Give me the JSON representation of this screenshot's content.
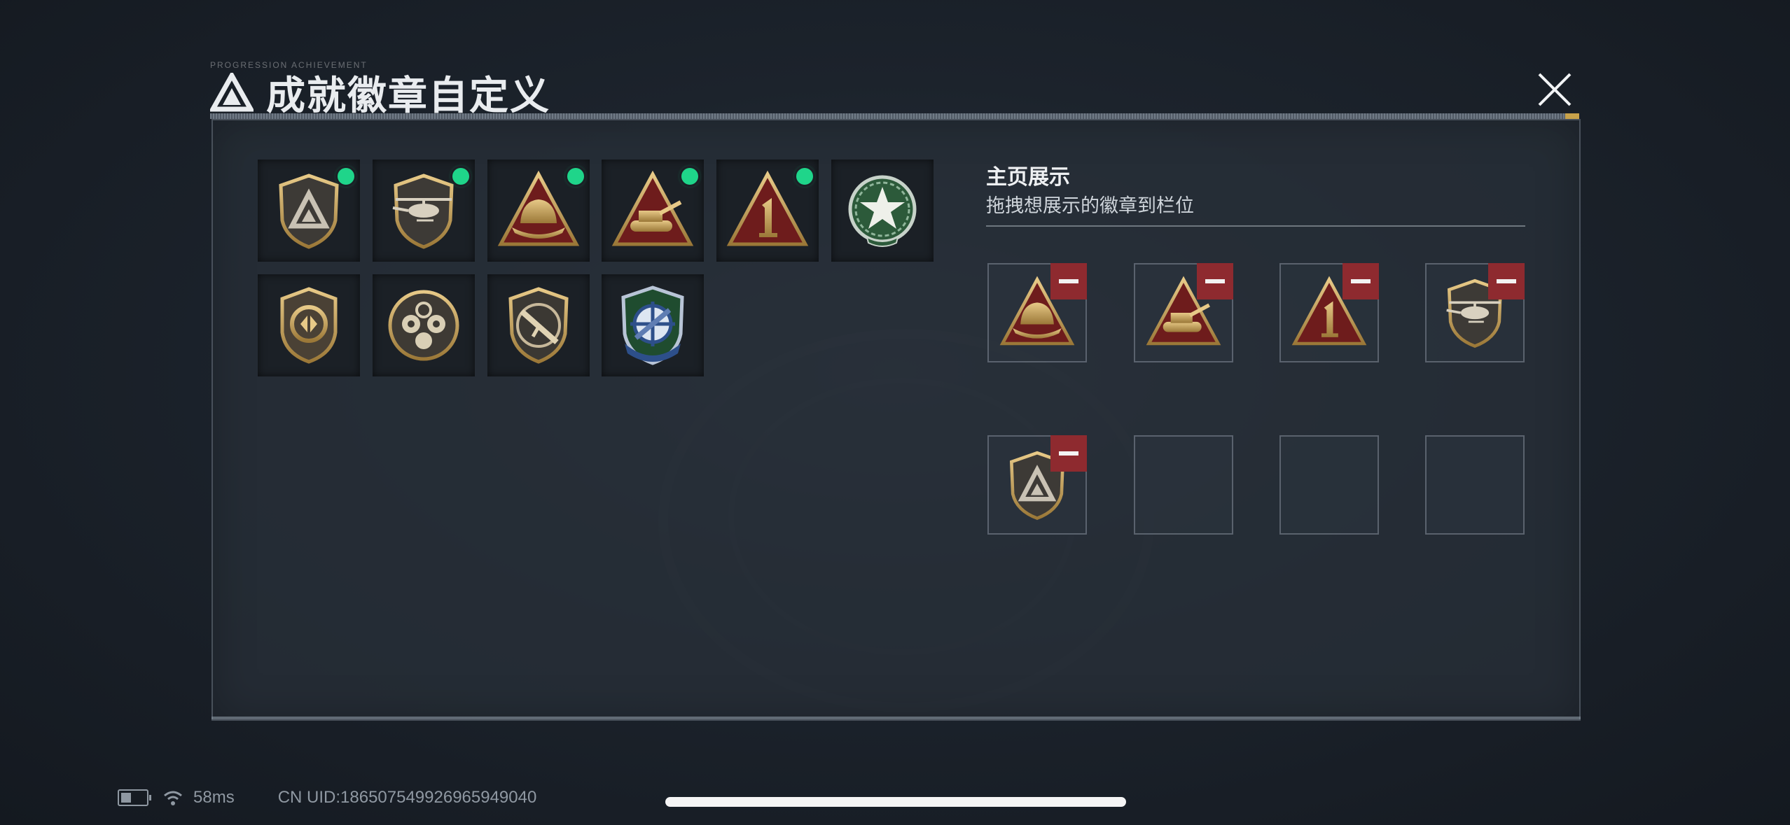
{
  "header": {
    "title": "成就徽章自定义",
    "tiny_text": "PROGRESSION ACHIEVEMENT",
    "close_icon": "close-icon"
  },
  "badges": [
    {
      "name": "badge-shield-triangle",
      "icon": "triangle-shield-icon",
      "new": true
    },
    {
      "name": "badge-helicopter",
      "icon": "helicopter-shield-icon",
      "new": true
    },
    {
      "name": "badge-helmet",
      "icon": "helmet-triangle-icon",
      "new": true
    },
    {
      "name": "badge-tank",
      "icon": "tank-triangle-icon",
      "new": true
    },
    {
      "name": "badge-number-one",
      "icon": "number-one-triangle-icon",
      "new": true
    },
    {
      "name": "badge-star-wreath",
      "icon": "star-wreath-icon",
      "new": false
    },
    {
      "name": "badge-arrows-shield",
      "icon": "arrows-shield-icon",
      "new": false
    },
    {
      "name": "badge-gas-mask",
      "icon": "gas-mask-icon",
      "new": false
    },
    {
      "name": "badge-rifle",
      "icon": "rifle-shield-icon",
      "new": false
    },
    {
      "name": "badge-crosshair",
      "icon": "crosshair-shield-icon",
      "new": false
    }
  ],
  "showcase": {
    "title": "主页展示",
    "subtitle": "拖拽想展示的徽章到栏位",
    "slots": [
      {
        "icon": "helmet-triangle-icon",
        "filled": true
      },
      {
        "icon": "tank-triangle-icon",
        "filled": true
      },
      {
        "icon": "number-one-triangle-icon",
        "filled": true
      },
      {
        "icon": "helicopter-shield-icon",
        "filled": true
      },
      {
        "icon": "triangle-shield-icon",
        "filled": true
      },
      {
        "icon": "",
        "filled": false
      },
      {
        "icon": "",
        "filled": false
      },
      {
        "icon": "",
        "filled": false
      }
    ]
  },
  "status_bar": {
    "ping": "58ms",
    "uid": "CN UID:1865075499269659490​40"
  },
  "colors": {
    "new_dot": "#1fd58a",
    "remove_button": "#8e2a2f",
    "gold": "#c9a35a",
    "dark_red": "#6e1c1c"
  }
}
